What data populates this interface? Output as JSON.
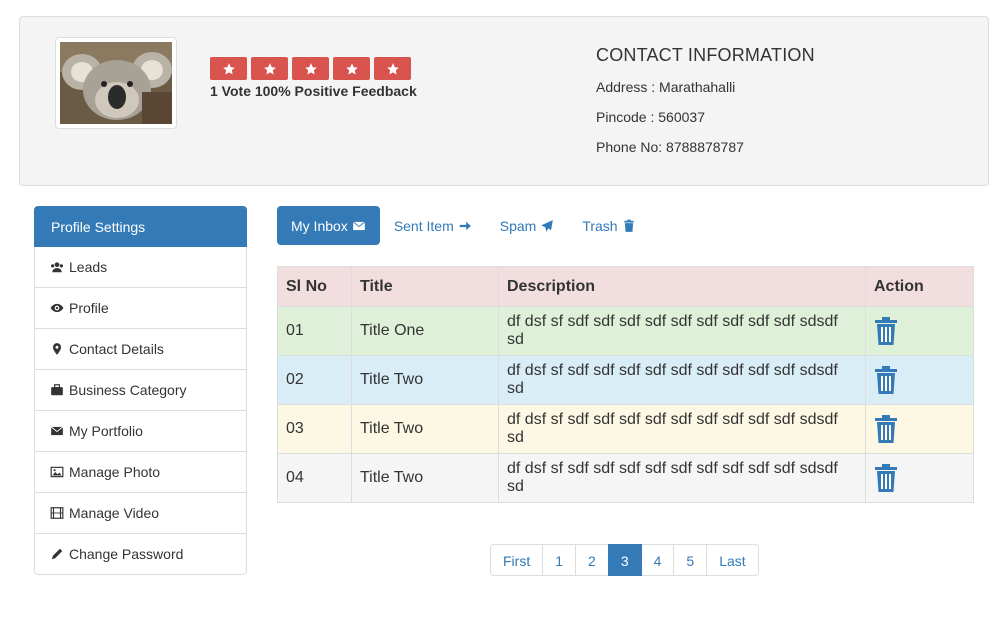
{
  "profile": {
    "rating_stars": 5,
    "feedback": "1 Vote 100% Positive Feedback",
    "star_color": "#d9534f"
  },
  "contact": {
    "title": "CONTACT INFORMATION",
    "address": "Address : Marathahalli",
    "pincode": "Pincode : 560037",
    "phone": "Phone No: 8788878787"
  },
  "sidebar": {
    "header": "Profile Settings",
    "items": [
      {
        "label": "Leads",
        "icon": "users-icon"
      },
      {
        "label": "Profile",
        "icon": "eye-icon"
      },
      {
        "label": "Contact Details",
        "icon": "map-marker-icon"
      },
      {
        "label": "Business Category",
        "icon": "briefcase-icon"
      },
      {
        "label": "My Portfolio",
        "icon": "envelope-icon"
      },
      {
        "label": "Manage Photo",
        "icon": "picture-icon"
      },
      {
        "label": "Manage Video",
        "icon": "film-icon"
      },
      {
        "label": "Change Password",
        "icon": "pencil-icon"
      }
    ]
  },
  "tabs": [
    {
      "label": "My Inbox",
      "icon": "envelope-icon",
      "active": true
    },
    {
      "label": "Sent Item",
      "icon": "arrow-right-icon",
      "active": false
    },
    {
      "label": "Spam",
      "icon": "send-icon",
      "active": false
    },
    {
      "label": "Trash",
      "icon": "trash-icon",
      "active": false
    }
  ],
  "table": {
    "headers": [
      "Sl No",
      "Title",
      "Description",
      "Action"
    ],
    "rows": [
      {
        "no": "01",
        "title": "Title One",
        "description": "df dsf sf sdf sdf sdf sdf sdf sdf sdf sdf sdf sdsdf sd"
      },
      {
        "no": "02",
        "title": "Title Two",
        "description": "df dsf sf sdf sdf sdf sdf sdf sdf sdf sdf sdf sdsdf sd"
      },
      {
        "no": "03",
        "title": "Title Two",
        "description": "df dsf sf sdf sdf sdf sdf sdf sdf sdf sdf sdf sdsdf sd"
      },
      {
        "no": "04",
        "title": "Title Two",
        "description": "df dsf sf sdf sdf sdf sdf sdf sdf sdf sdf sdf sdsdf sd"
      }
    ]
  },
  "pagination": {
    "items": [
      "First",
      "1",
      "2",
      "3",
      "4",
      "5",
      "Last"
    ],
    "active": "3"
  },
  "colors": {
    "primary": "#337ab7",
    "danger": "#d9534f"
  }
}
